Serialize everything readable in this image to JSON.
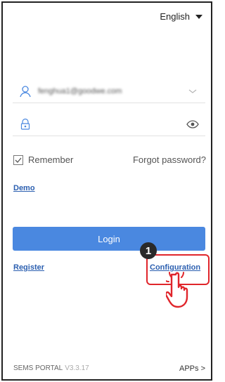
{
  "language": {
    "label": "English"
  },
  "login_form": {
    "username_value": "fenghua1@goodwe.com",
    "remember_label": "Remember",
    "forgot_label": "Forgot password?",
    "demo_label": "Demo",
    "login_label": "Login",
    "register_label": "Register",
    "configuration_label": "Configuration"
  },
  "annotation": {
    "step_number": "1",
    "highlight_color": "#e0252b"
  },
  "footer": {
    "portal_label": "SEMS PORTAL",
    "version": "V3.3.17",
    "apps_label": "APPs >"
  },
  "colors": {
    "primary": "#4a88e0",
    "link": "#2b5fb0"
  },
  "icons": [
    "user-icon",
    "chevron-down-icon",
    "lock-icon",
    "eye-icon",
    "checkbox-checked-icon",
    "pointing-hand-icon"
  ]
}
